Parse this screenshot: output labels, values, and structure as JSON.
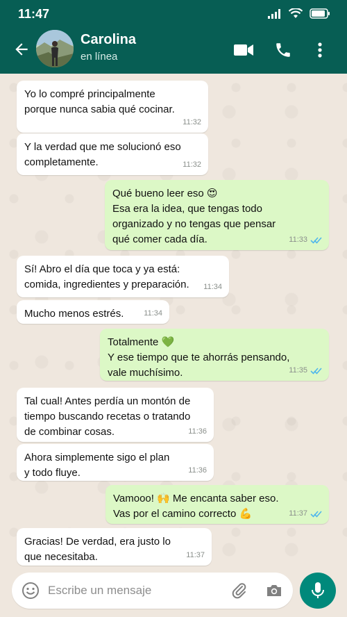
{
  "status_bar": {
    "time": "11:47"
  },
  "header": {
    "contact_name": "Carolina",
    "contact_status": "en línea",
    "icons": [
      "back-arrow-icon",
      "video-call-icon",
      "phone-icon",
      "more-vert-icon"
    ]
  },
  "messages": [
    {
      "dir": "in",
      "text": "Yo lo compré principalmente\nporque nunca sabia qué cocinar.",
      "time": "11:32"
    },
    {
      "dir": "in",
      "text": "Y la verdad que me solucionó eso\ncompletamente.",
      "time": "11:32"
    },
    {
      "dir": "out",
      "text": "Qué bueno leer eso 😍\nEsa era la idea, que tengas todo\norganizado y no tengas que pensar\nqué comer cada día.",
      "time": "11:33",
      "read": true
    },
    {
      "dir": "in",
      "text": "Sí! Abro el día que toca y ya está:\ncomida, ingredientes y preparación.",
      "time": "11:34"
    },
    {
      "dir": "in",
      "text": "Mucho menos estrés.",
      "time": "11:34"
    },
    {
      "dir": "out",
      "text": "Totalmente 💚\nY ese tiempo que te ahorrás pensando,\nvale muchísimo.",
      "time": "11:35",
      "read": true
    },
    {
      "dir": "in",
      "text": "Tal cual! Antes perdía un montón de\ntiempo buscando recetas o tratando\nde combinar cosas.",
      "time": "11:36"
    },
    {
      "dir": "in",
      "text": "Ahora simplemente sigo el plan\ny todo fluye.",
      "time": "11:36"
    },
    {
      "dir": "out",
      "text": "Vamooo! 🙌 Me encanta saber eso.\nVas por el camino correcto 💪",
      "time": "11:37",
      "read": true
    },
    {
      "dir": "in",
      "text": "Gracias! De verdad, era justo lo\nque necesitaba.",
      "time": "11:37"
    }
  ],
  "footer": {
    "input_placeholder": "Escribe un mensaje",
    "icons": [
      "emoji-icon",
      "paperclip-icon",
      "camera-icon",
      "mic-icon"
    ]
  },
  "colors": {
    "header": "#075e54",
    "incoming_bubble": "#ffffff",
    "outgoing_bubble": "#dcf8c6",
    "read_ticks": "#4fb6ec",
    "mic_button": "#00897b",
    "wallpaper": "#efe7de"
  }
}
